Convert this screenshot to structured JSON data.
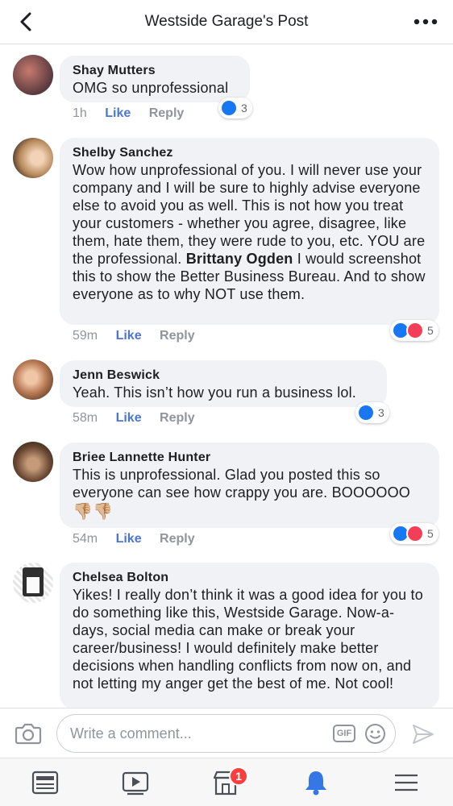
{
  "header": {
    "title": "Westside Garage's Post"
  },
  "comments": [
    {
      "author": "Shay Mutters",
      "text": "OMG so unprofessional",
      "time": "1h",
      "like_label": "Like",
      "reply_label": "Reply",
      "reactions": [
        "like"
      ],
      "reaction_count": "3"
    },
    {
      "author": "Shelby Sanchez",
      "text_part1": "Wow how unprofessional of you. I will never use your company and I will be sure to highly advise everyone else to avoid you as well. This is not how you treat your customers - whether you agree, disagree, like them, hate them, they were rude to you, etc. YOU are the professional.",
      "mention": "Brittany Ogden",
      "text_part2": " I would screenshot this to show the Better Business Bureau. And to show everyone as to why NOT use them.",
      "time": "59m",
      "like_label": "Like",
      "reply_label": "Reply",
      "reactions": [
        "like",
        "love"
      ],
      "reaction_count": "5"
    },
    {
      "author": "Jenn Beswick",
      "text": "Yeah. This isn’t how you run a business lol.",
      "time": "58m",
      "like_label": "Like",
      "reply_label": "Reply",
      "reactions": [
        "like"
      ],
      "reaction_count": "3"
    },
    {
      "author": "Briee Lannette Hunter",
      "text": "This is unprofessional. Glad you posted this so everyone can see how crappy you are. BOOOOOO",
      "emojis": "👎🏼👎🏼",
      "time": "54m",
      "like_label": "Like",
      "reply_label": "Reply",
      "reactions": [
        "like",
        "love"
      ],
      "reaction_count": "5"
    },
    {
      "author": "Chelsea Bolton",
      "text": "Yikes! I really don’t think it was a good idea for you to do something like this, Westside Garage. Now-a-days, social media can make or break your career/business! I would definitely make better decisions when handling conflicts from now on, and not letting my anger get the best of me. Not cool!"
    }
  ],
  "composer": {
    "placeholder": "Write a comment...",
    "gif_label": "GIF"
  },
  "bottom_nav": {
    "items": [
      "news-feed-icon",
      "watch-icon",
      "marketplace-icon",
      "notifications-icon",
      "menu-icon"
    ],
    "marketplace_badge": "1"
  },
  "colors": {
    "accent": "#4a76d9",
    "bubble": "#f0f2f5",
    "badge": "#fa3e3e",
    "like_reaction": "#1877f2",
    "love_reaction": "#f33e58"
  }
}
